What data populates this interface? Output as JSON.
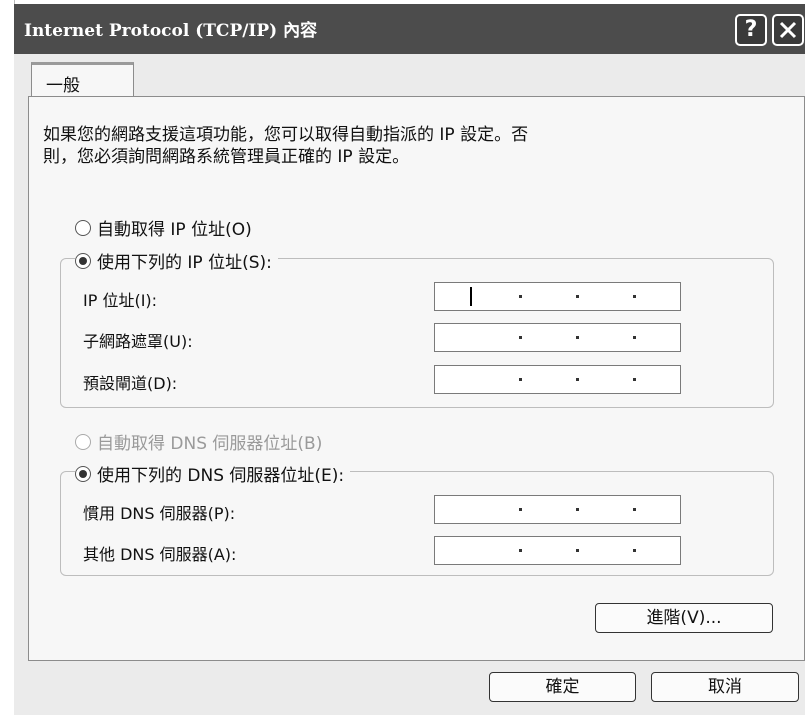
{
  "window": {
    "title": "Internet Protocol (TCP/IP) 內容",
    "help_label": "?"
  },
  "tabs": [
    {
      "label": "一般",
      "active": true
    }
  ],
  "description": {
    "line1": "如果您的網路支援這項功能，您可以取得自動指派的 IP 設定。否",
    "line2": "則，您必須詢問網路系統管理員正確的 IP 設定。"
  },
  "ip_section": {
    "auto_option": {
      "label": "自動取得 IP 位址(O)",
      "selected": false
    },
    "manual_option": {
      "label": "使用下列的 IP 位址(S):",
      "selected": true
    },
    "fields": [
      {
        "label": "IP 位址(I):",
        "value": "",
        "focused": true
      },
      {
        "label": "子網路遮罩(U):",
        "value": ""
      },
      {
        "label": "預設閘道(D):",
        "value": ""
      }
    ]
  },
  "dns_section": {
    "auto_option": {
      "label": "自動取得 DNS 伺服器位址(B)",
      "selected": false,
      "enabled": false
    },
    "manual_option": {
      "label": "使用下列的 DNS 伺服器位址(E):",
      "selected": true
    },
    "fields": [
      {
        "label": "慣用 DNS 伺服器(P):",
        "value": ""
      },
      {
        "label": "其他 DNS 伺服器(A):",
        "value": ""
      }
    ]
  },
  "buttons": {
    "advanced": "進階(V)...",
    "ok": "確定",
    "cancel": "取消"
  },
  "icons": {
    "help": "help-icon",
    "close": "close-icon"
  },
  "colors": {
    "titlebar": "#4c4c4c",
    "dialog": "#ebebeb",
    "panel": "#f7f7f7"
  }
}
